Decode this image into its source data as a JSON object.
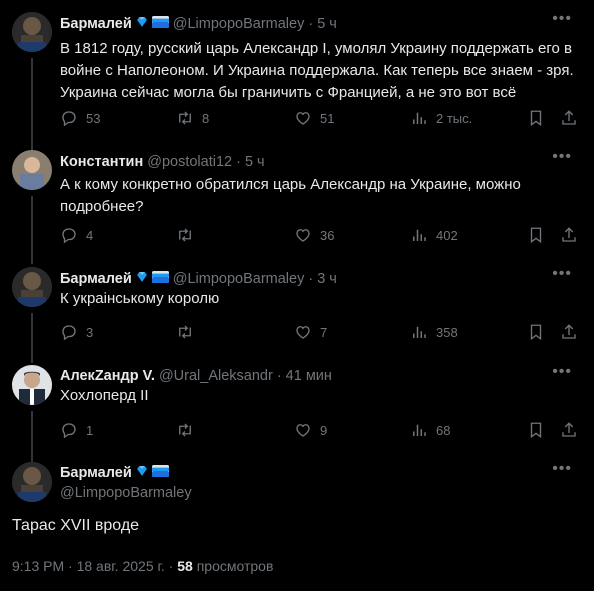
{
  "tweets": [
    {
      "name": "Бармалей",
      "handle": "@LimpopoBarmaley",
      "time": "5 ч",
      "lines": [
        "В 1812 году, русский царь Александр I, умолял Украину поддержать его в",
        "войне с Наполеоном. И Украина поддержала. Как теперь все знаем - зря.",
        "Украина сейчас могла бы граничить с Францией, а не это вот всё"
      ],
      "replies": "53",
      "retweets": "8",
      "likes": "51",
      "views": "2 тыс."
    },
    {
      "name": "Константин",
      "handle": "@postolati12",
      "time": "5 ч",
      "lines": [
        "А к кому конкретно обратился царь Александр на Украине, можно",
        "подробнее?"
      ],
      "replies": "4",
      "retweets": "",
      "likes": "36",
      "views": "402"
    },
    {
      "name": "Бармалей",
      "handle": "@LimpopoBarmaley",
      "time": "3 ч",
      "lines": [
        "К украінському королю"
      ],
      "replies": "3",
      "retweets": "",
      "likes": "7",
      "views": "358"
    },
    {
      "name": "АлекZандр V.",
      "handle": "@Ural_Aleksandr",
      "time": "41 мин",
      "lines": [
        "Хохлоперд II"
      ],
      "replies": "1",
      "retweets": "",
      "likes": "9",
      "views": "68"
    }
  ],
  "main": {
    "name": "Бармалей",
    "handle": "@LimpopoBarmaley",
    "text": "Тарас XVII  вроде",
    "time": "9:13 PM",
    "date": "18 авг. 2025 г.",
    "views_count": "58",
    "views_label": "просмотров"
  },
  "separator": "·",
  "colors": {
    "background": "#000000",
    "text": "#e7e9ea",
    "muted": "#71767b",
    "badge_blue": "#1d9bf0"
  },
  "icons": [
    "reply-icon",
    "retweet-icon",
    "like-icon",
    "views-icon",
    "bookmark-icon",
    "share-icon",
    "more-icon",
    "diamond-badge-icon",
    "flag-badge-icon"
  ]
}
